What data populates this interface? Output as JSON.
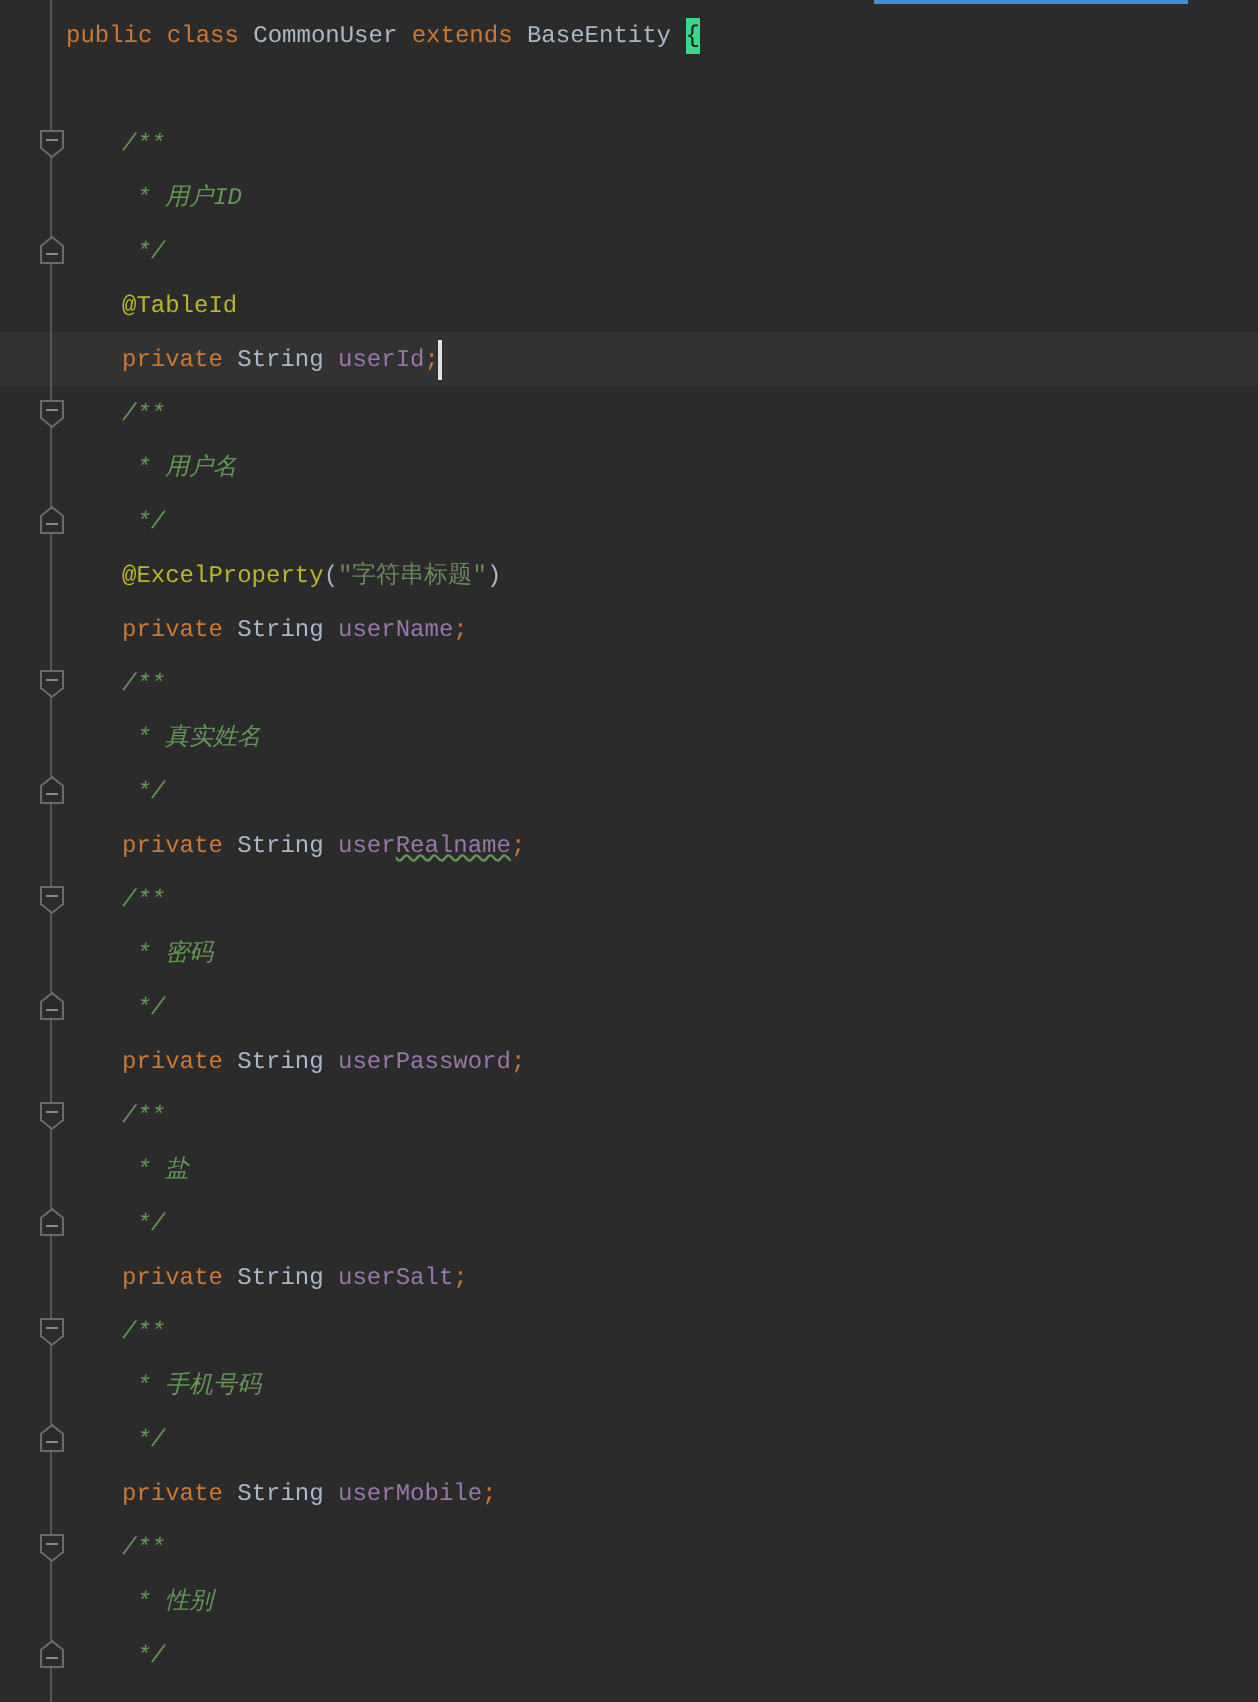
{
  "editor": {
    "class_line": {
      "tokens": [
        {
          "text": "public",
          "kind": "keyword"
        },
        {
          "text": " class",
          "kind": "keyword"
        },
        {
          "text": " CommonUser ",
          "kind": "plain"
        },
        {
          "text": "extends",
          "kind": "keyword"
        },
        {
          "text": " BaseEntity ",
          "kind": "plain"
        },
        {
          "text": "{",
          "kind": "brace_match"
        }
      ]
    },
    "members": [
      {
        "tokens": [
          {
            "text": "/**",
            "kind": "comment"
          }
        ],
        "kind": "fold_start",
        "current": false
      },
      {
        "tokens": [
          {
            "text": " * 用户ID",
            "kind": "comment"
          }
        ],
        "kind": "code",
        "current": false
      },
      {
        "tokens": [
          {
            "text": " */",
            "kind": "comment"
          }
        ],
        "kind": "fold_end",
        "current": false
      },
      {
        "tokens": [
          {
            "text": "@TableId",
            "kind": "annotation"
          }
        ],
        "kind": "code",
        "current": false
      },
      {
        "tokens": [
          {
            "text": "private",
            "kind": "keyword"
          },
          {
            "text": " String ",
            "kind": "plain"
          },
          {
            "text": "userId",
            "kind": "field"
          },
          {
            "text": ";",
            "kind": "keyword"
          }
        ],
        "kind": "code",
        "current": true
      },
      {
        "tokens": [
          {
            "text": "/**",
            "kind": "comment"
          }
        ],
        "kind": "fold_start",
        "current": false
      },
      {
        "tokens": [
          {
            "text": " * 用户名",
            "kind": "comment"
          }
        ],
        "kind": "code",
        "current": false
      },
      {
        "tokens": [
          {
            "text": " */",
            "kind": "comment"
          }
        ],
        "kind": "fold_end",
        "current": false
      },
      {
        "tokens": [
          {
            "text": "@ExcelProperty",
            "kind": "annotation"
          },
          {
            "text": "(",
            "kind": "plain"
          },
          {
            "text": "\"字符串标题\"",
            "kind": "string"
          },
          {
            "text": ")",
            "kind": "plain"
          }
        ],
        "kind": "code",
        "current": false
      },
      {
        "tokens": [
          {
            "text": "private",
            "kind": "keyword"
          },
          {
            "text": " String ",
            "kind": "plain"
          },
          {
            "text": "userName",
            "kind": "field"
          },
          {
            "text": ";",
            "kind": "keyword"
          }
        ],
        "kind": "code",
        "current": false
      },
      {
        "tokens": [
          {
            "text": "/**",
            "kind": "comment"
          }
        ],
        "kind": "fold_start",
        "current": false
      },
      {
        "tokens": [
          {
            "text": " * 真实姓名",
            "kind": "comment"
          }
        ],
        "kind": "code",
        "current": false
      },
      {
        "tokens": [
          {
            "text": " */",
            "kind": "comment"
          }
        ],
        "kind": "fold_end",
        "current": false
      },
      {
        "tokens": [
          {
            "text": "private",
            "kind": "keyword"
          },
          {
            "text": " String ",
            "kind": "plain"
          },
          {
            "text": "user",
            "kind": "field"
          },
          {
            "text": "Realname",
            "kind": "typo"
          },
          {
            "text": ";",
            "kind": "keyword"
          }
        ],
        "kind": "code",
        "current": false
      },
      {
        "tokens": [
          {
            "text": "/**",
            "kind": "comment"
          }
        ],
        "kind": "fold_start",
        "current": false
      },
      {
        "tokens": [
          {
            "text": " * 密码",
            "kind": "comment"
          }
        ],
        "kind": "code",
        "current": false
      },
      {
        "tokens": [
          {
            "text": " */",
            "kind": "comment"
          }
        ],
        "kind": "fold_end",
        "current": false
      },
      {
        "tokens": [
          {
            "text": "private",
            "kind": "keyword"
          },
          {
            "text": " String ",
            "kind": "plain"
          },
          {
            "text": "userPassword",
            "kind": "field"
          },
          {
            "text": ";",
            "kind": "keyword"
          }
        ],
        "kind": "code",
        "current": false
      },
      {
        "tokens": [
          {
            "text": "/**",
            "kind": "comment"
          }
        ],
        "kind": "fold_start",
        "current": false
      },
      {
        "tokens": [
          {
            "text": " * 盐",
            "kind": "comment"
          }
        ],
        "kind": "code",
        "current": false
      },
      {
        "tokens": [
          {
            "text": " */",
            "kind": "comment"
          }
        ],
        "kind": "fold_end",
        "current": false
      },
      {
        "tokens": [
          {
            "text": "private",
            "kind": "keyword"
          },
          {
            "text": " String ",
            "kind": "plain"
          },
          {
            "text": "userSalt",
            "kind": "field"
          },
          {
            "text": ";",
            "kind": "keyword"
          }
        ],
        "kind": "code",
        "current": false
      },
      {
        "tokens": [
          {
            "text": "/**",
            "kind": "comment"
          }
        ],
        "kind": "fold_start",
        "current": false
      },
      {
        "tokens": [
          {
            "text": " * 手机号码",
            "kind": "comment"
          }
        ],
        "kind": "code",
        "current": false
      },
      {
        "tokens": [
          {
            "text": " */",
            "kind": "comment"
          }
        ],
        "kind": "fold_end",
        "current": false
      },
      {
        "tokens": [
          {
            "text": "private",
            "kind": "keyword"
          },
          {
            "text": " String ",
            "kind": "plain"
          },
          {
            "text": "userMobile",
            "kind": "field"
          },
          {
            "text": ";",
            "kind": "keyword"
          }
        ],
        "kind": "code",
        "current": false
      },
      {
        "tokens": [
          {
            "text": "/**",
            "kind": "comment"
          }
        ],
        "kind": "fold_start",
        "current": false
      },
      {
        "tokens": [
          {
            "text": " * 性别",
            "kind": "comment"
          }
        ],
        "kind": "code",
        "current": false
      },
      {
        "tokens": [
          {
            "text": " */",
            "kind": "comment"
          }
        ],
        "kind": "fold_end",
        "current": false
      }
    ]
  }
}
